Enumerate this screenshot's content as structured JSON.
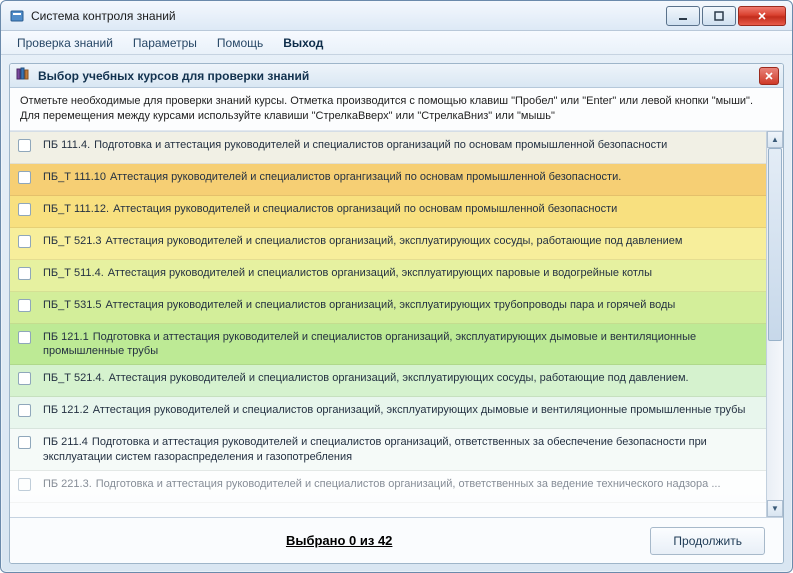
{
  "window": {
    "title": "Система контроля знаний"
  },
  "menu": {
    "items": [
      "Проверка знаний",
      "Параметры",
      "Помощь",
      "Выход"
    ],
    "bold_index": 3
  },
  "panel": {
    "title": "Выбор учебных курсов для проверки знаний",
    "instructions_line1": "Отметьте необходимые для проверки знаний курсы. Отметка производится с помощью клавиш \"Пробел\" или \"Enter\" или левой кнопки \"мыши\".",
    "instructions_line2": "Для перемещения между курсами используйте клавиши \"СтрелкаВверх\" или \"СтрелкаВниз\" или \"мышь\""
  },
  "courses": [
    {
      "code": "ПБ 111.4.",
      "label": "Подготовка и аттестация руководителей и специалистов организаций по основам промышленной безопасности",
      "bg": "#f1f0e5"
    },
    {
      "code": "ПБ_Т 111.10",
      "label": "Аттестация руководителей и специалистов органгизаций по основам промышленной безопасности.",
      "bg": "#f6cf74"
    },
    {
      "code": "ПБ_Т 111.12.",
      "label": "Аттестация руководителей и специалистов организаций по основам промышленной безопасности",
      "bg": "#f8e07f"
    },
    {
      "code": "ПБ_Т 521.3",
      "label": "Аттестация руководителей и специалистов организаций, эксплуатирующих сосуды, работающие под давлением",
      "bg": "#f7ee9b"
    },
    {
      "code": "ПБ_Т 511.4.",
      "label": "Аттестация руководителей и специалистов организаций, эксплуатирующих паровые и водогрейные котлы",
      "bg": "#e6f1a0"
    },
    {
      "code": "ПБ_Т 531.5",
      "label": "Аттестация руководителей и специалистов организаций, эксплуатирующих трубопроводы пара и горячей воды",
      "bg": "#d3ee9a"
    },
    {
      "code": "ПБ 121.1",
      "label": "Подготовка и аттестация руководителей и специалистов организаций, эксплуатирующих дымовые и вентиляционные промышленные трубы",
      "bg": "#bdea95"
    },
    {
      "code": "ПБ_Т 521.4.",
      "label": "Аттестация руководителей и специалистов организаций, эксплуатирующих сосуды, работающие под давлением.",
      "bg": "#d5f2ce"
    },
    {
      "code": "ПБ 121.2",
      "label": "Аттестация руководителей и специалистов организаций, эксплуатирующих  дымовые и вентиляционные промышленные трубы",
      "bg": "#e8f6ed"
    },
    {
      "code": "ПБ 211.4",
      "label": "Подготовка и аттестация руководителей и специалистов организаций, ответственных за обеспечение безопасности при эксплуатации систем газораспределения и газопотребления",
      "bg": "#f5faf8"
    },
    {
      "code": "ПБ 221.3.",
      "label": "Подготовка и аттестация руководителей и специалистов организаций, ответственных за ведение технического надзора ...",
      "bg": "#ffffff",
      "partial": true
    }
  ],
  "footer": {
    "counter": "Выбрано 0 из 42",
    "continue": "Продолжить"
  }
}
